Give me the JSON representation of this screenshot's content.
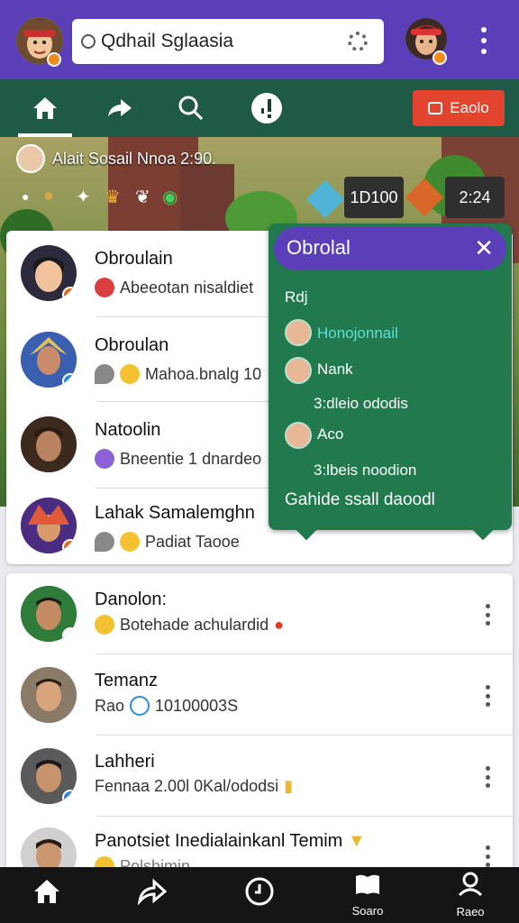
{
  "header": {
    "search_text": "Qdhail Sglaasia",
    "search_icon": "search-icon",
    "settings_icon": "gear-icon",
    "menu_icon": "more-vert-icon"
  },
  "nav": {
    "tabs": [
      {
        "icon": "home-icon"
      },
      {
        "icon": "share-icon"
      },
      {
        "icon": "search-icon"
      },
      {
        "icon": "alert-icon"
      }
    ],
    "red_button_label": "Eaolo",
    "red_button_icon": "camera-icon"
  },
  "banner": {
    "text": "Alait Sosail Nnoa 2:90.",
    "hud_left_value": "1D100",
    "hud_right_value": "2:24"
  },
  "top_list": [
    {
      "name": "Obroulain",
      "subtitle": "Abeeotan nisaldiet"
    },
    {
      "name": "Obroulan",
      "subtitle": "Mahoa.bnalg 10"
    },
    {
      "name": "Natoolin",
      "subtitle": "Bneentie 1 dnardeo"
    },
    {
      "name": "Lahak Samalemghn",
      "subtitle": "Padiat Taooe"
    }
  ],
  "popup": {
    "title": "Obrolal",
    "label": "Rdj",
    "entries": [
      {
        "name": "Honojonnail",
        "detail": ""
      },
      {
        "name": "Nank",
        "detail": "3:dleio ododis"
      },
      {
        "name": "Aco",
        "detail": "3:lbeis noodion"
      }
    ],
    "footer": "Gahide ssall daoodl"
  },
  "bottom_list": [
    {
      "name": "Danolon:",
      "subtitle": "Botehade achulardid"
    },
    {
      "name": "Temanz",
      "subtitle": "10100003S",
      "prefix": "Rao"
    },
    {
      "name": "Lahheri",
      "subtitle": "Fennaa 2.00l 0Kal/ododsi"
    },
    {
      "name": "Panotsiet Inedialainkanl Temim",
      "subtitle": "Polshimin"
    }
  ],
  "bottomnav": {
    "items": [
      {
        "icon": "home-icon",
        "label": ""
      },
      {
        "icon": "share-icon",
        "label": ""
      },
      {
        "icon": "clock-icon",
        "label": ""
      },
      {
        "icon": "book-icon",
        "label": "Soaro"
      },
      {
        "icon": "profile-icon",
        "label": "Raeo"
      }
    ]
  },
  "colors": {
    "header": "#5b3fb8",
    "navbar": "#1f5a46",
    "popup": "#22794e",
    "accent_red": "#e2442f"
  }
}
